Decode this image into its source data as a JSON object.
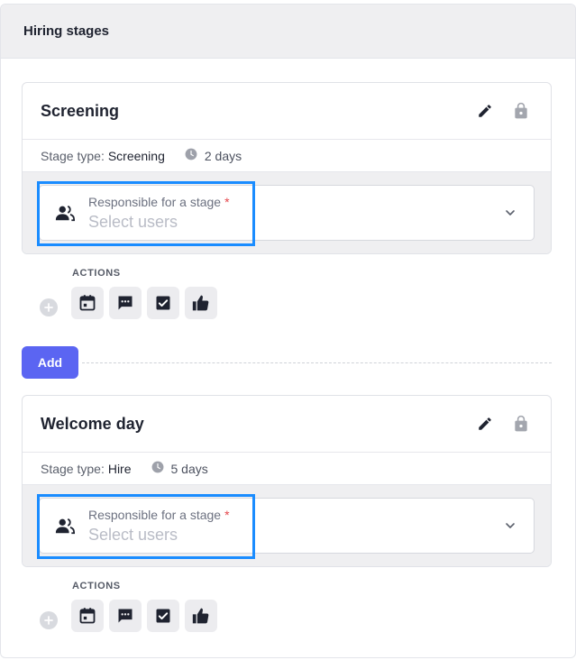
{
  "panel": {
    "title": "Hiring stages"
  },
  "stages": [
    {
      "name": "Screening",
      "type_label": "Stage type:",
      "type_value": "Screening",
      "duration": "2 days",
      "responsible_label": "Responsible for a stage",
      "required_mark": "*",
      "placeholder": "Select users",
      "actions_label": "ACTIONS"
    },
    {
      "name": "Welcome day",
      "type_label": "Stage type:",
      "type_value": "Hire",
      "duration": "5 days",
      "responsible_label": "Responsible for a stage",
      "required_mark": "*",
      "placeholder": "Select users",
      "actions_label": "ACTIONS"
    }
  ],
  "add_button_label": "Add",
  "icons": {
    "edit": "pencil-icon",
    "lock": "lock-icon",
    "clock": "clock-icon",
    "users": "users-icon",
    "chevron": "chevron-down-icon",
    "plus": "plus-circle-icon",
    "actions": [
      "calendar-icon",
      "message-icon",
      "checkbox-icon",
      "thumbs-up-icon"
    ]
  },
  "colors": {
    "accent": "#5b65f2",
    "focus_outline": "#1a8cff",
    "required": "#e5484d"
  }
}
